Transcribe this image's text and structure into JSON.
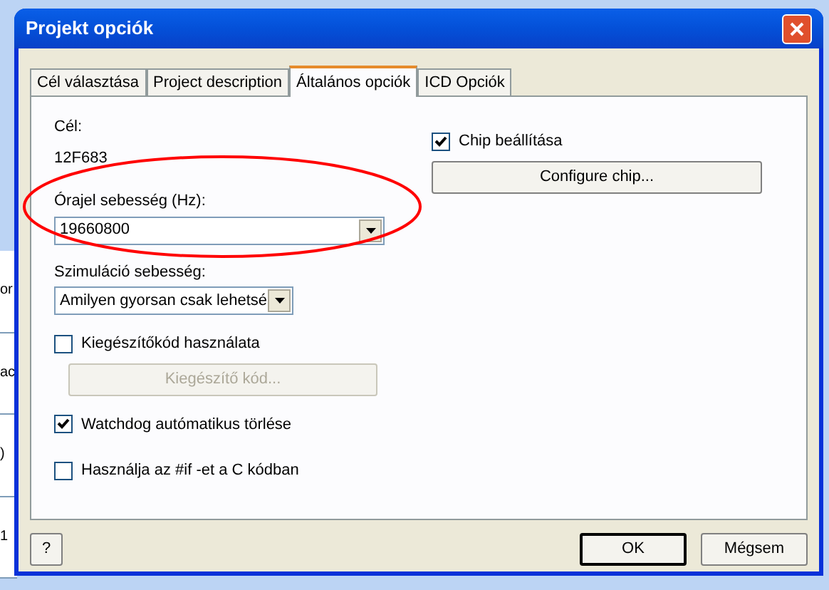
{
  "background_window": {
    "fragments": [
      "or",
      "ac",
      ")",
      "1"
    ]
  },
  "window": {
    "title": "Projekt opciók"
  },
  "tabs": [
    {
      "label": "Cél választása",
      "selected": false
    },
    {
      "label": "Project description",
      "selected": false
    },
    {
      "label": "Általános opciók",
      "selected": true
    },
    {
      "label": "ICD Opciók",
      "selected": false
    }
  ],
  "target": {
    "label": "Cél:",
    "value": "12F683"
  },
  "clock": {
    "label": "Órajel sebesség (Hz):",
    "value": "19660800"
  },
  "simulation": {
    "label": "Szimuláció sebesség:",
    "value": "Amilyen gyorsan csak lehetsé"
  },
  "extension": {
    "label": "Kiegészítőkód használata",
    "checked": false,
    "button": "Kiegészítő kód...",
    "disabled": true
  },
  "watchdog": {
    "label": "Watchdog autómatikus törlése",
    "checked": true
  },
  "use_if": {
    "label": "Használja az #if -et a C kódban",
    "checked": false
  },
  "chip": {
    "label": "Chip beállítása",
    "checked": true,
    "button": "Configure chip..."
  },
  "annotations": [
    {
      "kind": "ellipse"
    }
  ],
  "buttons": {
    "help": "?",
    "ok": "OK",
    "cancel": "Mégsem"
  }
}
